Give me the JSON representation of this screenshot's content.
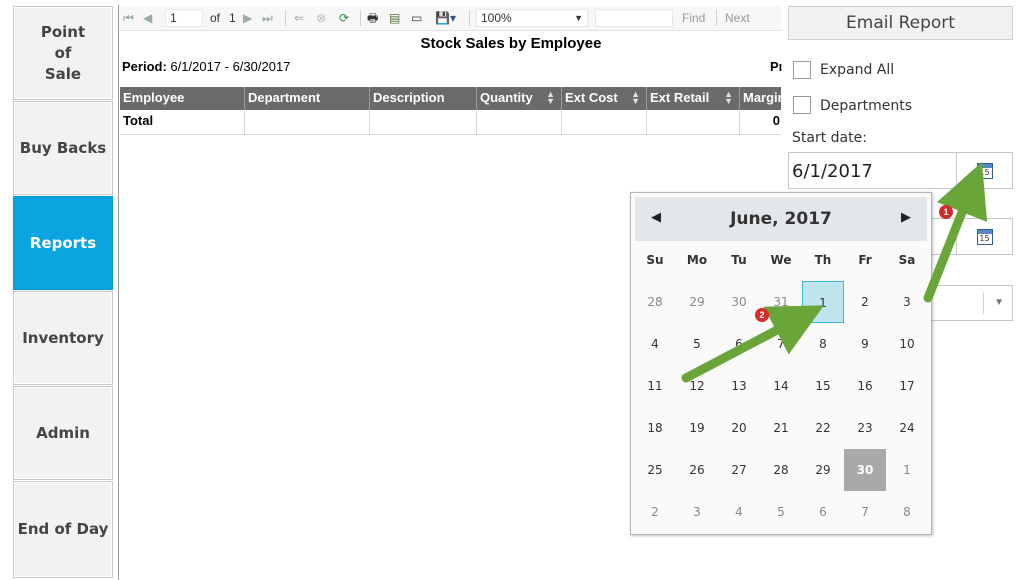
{
  "nav": {
    "point_of_sale": "Point\nof\nSale",
    "buy_backs": "Buy Backs",
    "reports": "Reports",
    "inventory": "Inventory",
    "admin": "Admin",
    "end_of_day": "End of Day"
  },
  "toolbar": {
    "page_value": "1",
    "of_label": "of",
    "total_pages": "1",
    "zoom": "100%",
    "find_label": "Find",
    "next_label": "Next"
  },
  "report": {
    "title": "Stock Sales by Employee",
    "period_label": "Period:",
    "period_value": "6/1/2017 - 6/30/2017",
    "right_cut": "Pı",
    "columns": [
      "Employee",
      "Department",
      "Description",
      "Quantity",
      "Ext Cost",
      "Ext Retail",
      "Margin"
    ],
    "total_label": "Total",
    "total_margin": "0"
  },
  "panel": {
    "email_report": "Email Report",
    "expand_all": "Expand All",
    "departments": "Departments",
    "start_date_label": "Start date:",
    "start_date_value": "6/1/2017"
  },
  "calendar": {
    "month_title": "June, 2017",
    "weekdays": [
      "Su",
      "Mo",
      "Tu",
      "We",
      "Th",
      "Fr",
      "Sa"
    ],
    "weeks": [
      [
        "28",
        "29",
        "30",
        "31",
        "1",
        "2",
        "3"
      ],
      [
        "4",
        "5",
        "6",
        "7",
        "8",
        "9",
        "10"
      ],
      [
        "11",
        "12",
        "13",
        "14",
        "15",
        "16",
        "17"
      ],
      [
        "18",
        "19",
        "20",
        "21",
        "22",
        "23",
        "24"
      ],
      [
        "25",
        "26",
        "27",
        "28",
        "29",
        "30",
        "1"
      ],
      [
        "2",
        "3",
        "4",
        "5",
        "6",
        "7",
        "8"
      ]
    ],
    "selected_day": "1",
    "highlighted_day": "30",
    "icon_day": "15"
  },
  "annotations": {
    "badge_1": "1",
    "badge_2": "2",
    "arrow_color": "#6aa53a"
  }
}
